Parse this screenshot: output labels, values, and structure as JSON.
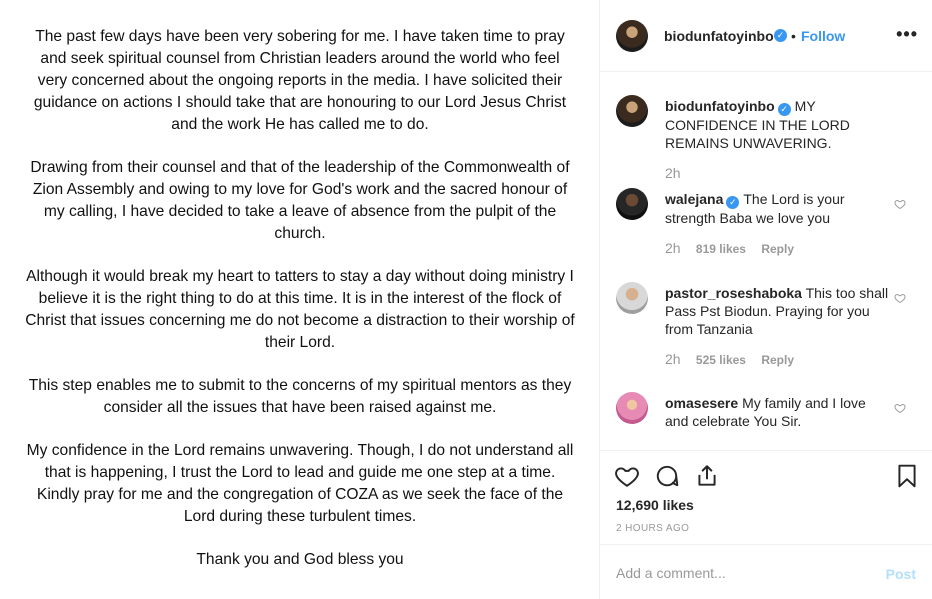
{
  "post_image": {
    "paragraphs": [
      "The past few days have been very sobering for me. I have taken time to pray and seek spiritual counsel from Christian leaders around the world who feel very concerned about the ongoing reports in the media. I have solicited their guidance on actions I should take that are honouring to our Lord Jesus Christ and the work He has called me to do.",
      "Drawing from their counsel and that of the leadership of the Commonwealth of Zion Assembly and owing to my love for God's work and the sacred honour of my calling, I have decided to take a leave of absence from the pulpit of the church.",
      "Although it would break my heart to tatters to stay a day without doing ministry I believe it is the right thing to do at this time. It is in the interest of the flock of Christ that issues concerning me do not become a distraction to their worship of their Lord.",
      "This step enables me to submit to the concerns of my spiritual mentors as they consider all the issues that have been raised against me.",
      "My confidence in the Lord remains unwavering. Though, I do not understand all that is happening, I trust the Lord to lead and guide me one step at a time. Kindly pray for me and the congregation of COZA as we seek the face of the Lord during these turbulent times.",
      "Thank you and God bless you"
    ]
  },
  "header": {
    "username": "biodunfatoyinbo",
    "separator": "•",
    "follow_label": "Follow",
    "more_label": "•••"
  },
  "caption": {
    "username": "biodunfatoyinbo",
    "text": "MY CONFIDENCE IN THE LORD REMAINS UNWAVERING.",
    "time": "2h"
  },
  "comments": [
    {
      "username": "walejana",
      "verified": true,
      "text": "The Lord is your strength Baba we love you",
      "time": "2h",
      "likes": "819 likes",
      "reply": "Reply"
    },
    {
      "username": "pastor_roseshaboka",
      "verified": false,
      "text": "This too shall Pass Pst Biodun. Praying for you from Tanzania",
      "time": "2h",
      "likes": "525 likes",
      "reply": "Reply"
    },
    {
      "username": "omasesere",
      "verified": false,
      "text": "My family and I love and celebrate You Sir."
    }
  ],
  "actions": {
    "likes_count": "12,690 likes",
    "timestamp": "2 HOURS AGO"
  },
  "add_comment": {
    "placeholder": "Add a comment...",
    "post_label": "Post"
  },
  "icons": [
    "verified-icon",
    "more-icon",
    "heart-icon",
    "comment-icon",
    "share-icon",
    "bookmark-icon"
  ],
  "colors": {
    "link_blue": "#3897f0",
    "muted": "#999999",
    "border": "#efefef",
    "post_disabled": "#b2dffc"
  }
}
